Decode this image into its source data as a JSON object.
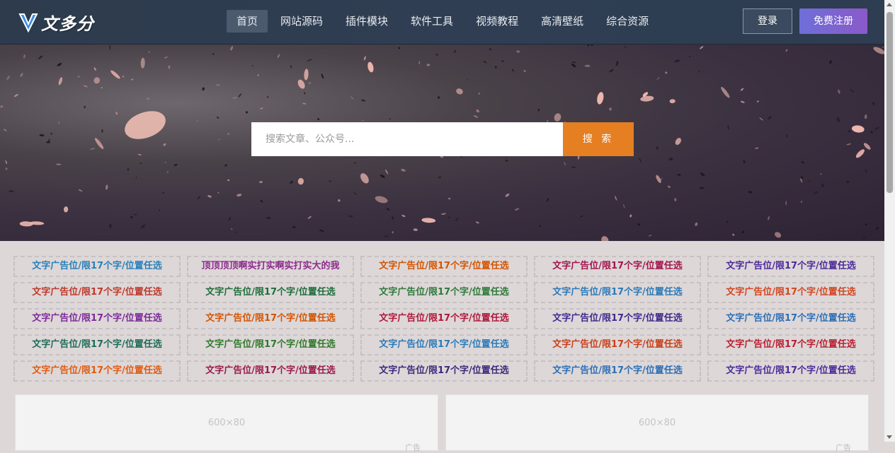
{
  "logo": {
    "text": "文多分"
  },
  "nav": [
    {
      "label": "首页",
      "active": true
    },
    {
      "label": "网站源码"
    },
    {
      "label": "插件模块"
    },
    {
      "label": "软件工具"
    },
    {
      "label": "视频教程"
    },
    {
      "label": "高清壁纸"
    },
    {
      "label": "综合资源"
    }
  ],
  "auth": {
    "login": "登录",
    "register": "免费注册"
  },
  "search": {
    "placeholder": "搜索文章、公众号...",
    "button": "搜 索"
  },
  "ads": [
    [
      {
        "text": "文字广告位/限17个字/位置任选",
        "color": "#2980b9"
      },
      {
        "text": "顶顶顶顶啊实打实啊实打实大的我",
        "color": "#8e2c8c"
      },
      {
        "text": "文字广告位/限17个字/位置任选",
        "color": "#d35400"
      },
      {
        "text": "文字广告位/限17个字/位置任选",
        "color": "#a3154d"
      },
      {
        "text": "文字广告位/限17个字/位置任选",
        "color": "#4b2a99"
      }
    ],
    [
      {
        "text": "文字广告位/限17个字/位置任选",
        "color": "#c0392b"
      },
      {
        "text": "文字广告位/限17个字/位置任选",
        "color": "#1e6e3a"
      },
      {
        "text": "文字广告位/限17个字/位置任选",
        "color": "#2f7a3a"
      },
      {
        "text": "文字广告位/限17个字/位置任选",
        "color": "#2c7ab8"
      },
      {
        "text": "文字广告位/限17个字/位置任选",
        "color": "#d3461f"
      }
    ],
    [
      {
        "text": "文字广告位/限17个字/位置任选",
        "color": "#7d2a9a"
      },
      {
        "text": "文字广告位/限17个字/位置任选",
        "color": "#d35400"
      },
      {
        "text": "文字广告位/限17个字/位置任选",
        "color": "#b0173a"
      },
      {
        "text": "文字广告位/限17个字/位置任选",
        "color": "#3f2a8c"
      },
      {
        "text": "文字广告位/限17个字/位置任选",
        "color": "#2c6fb5"
      }
    ],
    [
      {
        "text": "文字广告位/限17个字/位置任选",
        "color": "#1e6b57"
      },
      {
        "text": "文字广告位/限17个字/位置任选",
        "color": "#2f7a2a"
      },
      {
        "text": "文字广告位/限17个字/位置任选",
        "color": "#2c7ab8"
      },
      {
        "text": "文字广告位/限17个字/位置任选",
        "color": "#c8401a"
      },
      {
        "text": "文字广告位/限17个字/位置任选",
        "color": "#b81e2e"
      }
    ],
    [
      {
        "text": "文字广告位/限17个字/位置任选",
        "color": "#e05a10"
      },
      {
        "text": "文字广告位/限17个字/位置任选",
        "color": "#9a1a4a"
      },
      {
        "text": "文字广告位/限17个字/位置任选",
        "color": "#3a2a7a"
      },
      {
        "text": "文字广告位/限17个字/位置任选",
        "color": "#2c6fb5"
      },
      {
        "text": "文字广告位/限17个字/位置任选",
        "color": "#4b2a99"
      }
    ]
  ],
  "banners": [
    {
      "text": "600×80",
      "tag": "广告"
    },
    {
      "text": "600×80",
      "tag": "广告"
    }
  ]
}
